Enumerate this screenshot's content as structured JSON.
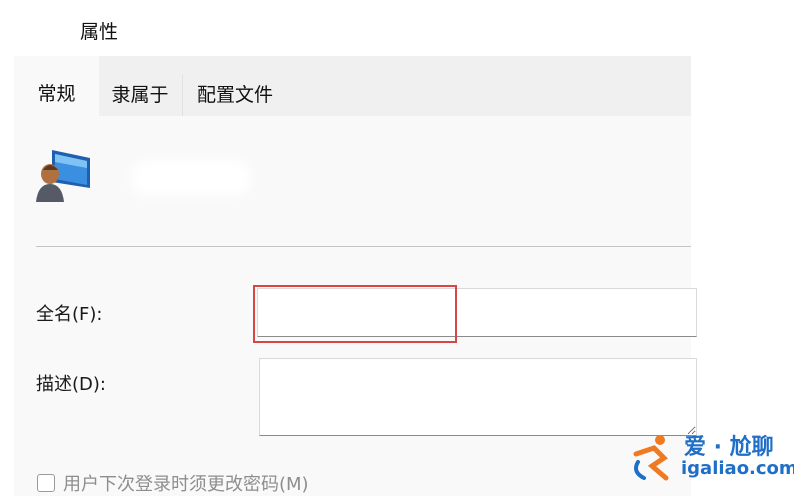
{
  "window": {
    "title": "属性"
  },
  "tabs": [
    {
      "label": "常规",
      "active": true
    },
    {
      "label": "隶属于",
      "active": false
    },
    {
      "label": "配置文件",
      "active": false
    }
  ],
  "general": {
    "user_icon": "user-computer-icon",
    "fullname": {
      "label": "全名(F):",
      "value": ""
    },
    "description": {
      "label": "描述(D):",
      "value": ""
    },
    "change_password": {
      "label": "用户下次登录时须更改密码(M)",
      "checked": false,
      "enabled": false
    }
  },
  "watermark": {
    "line1": "爱 · 尬聊",
    "line2": "igaliao.com",
    "color": "#1f6fc9"
  },
  "colors": {
    "highlight": "#d94545",
    "tabbar": "#f0f0f0",
    "panel": "#f9f9f9"
  }
}
